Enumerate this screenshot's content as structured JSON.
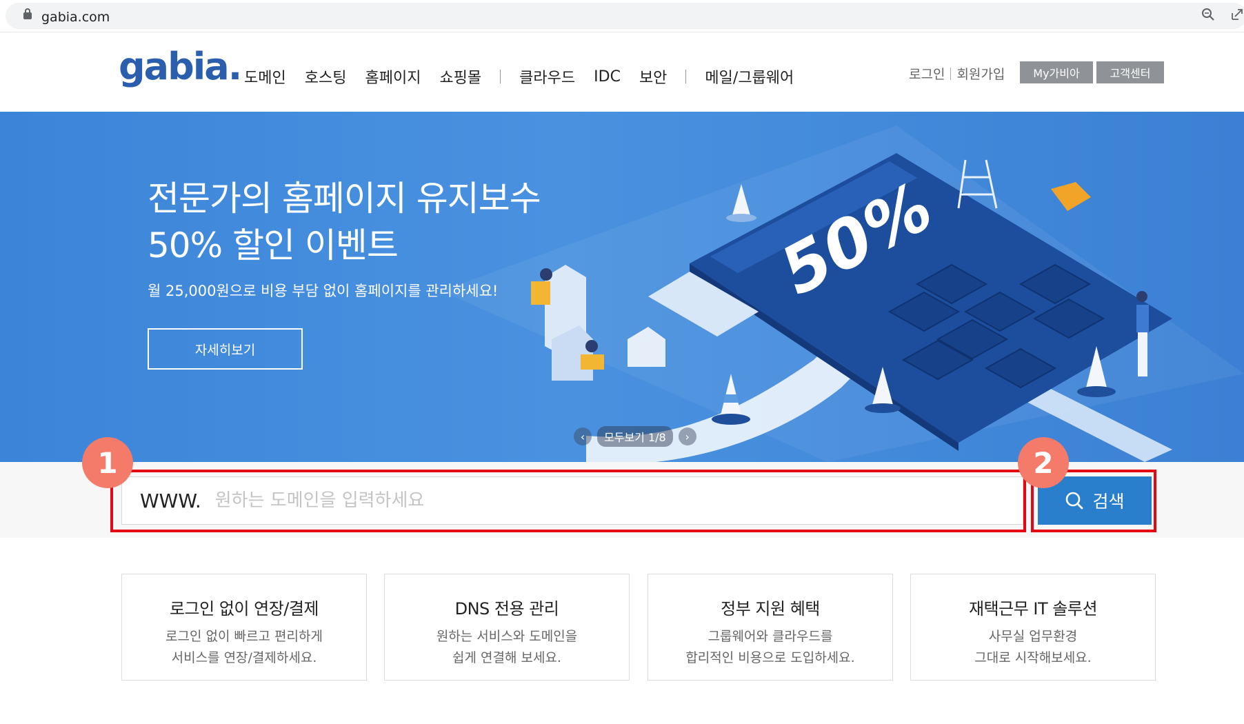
{
  "browser": {
    "url": "gabia.com"
  },
  "header": {
    "logo": "gabia.",
    "nav": [
      "도메인",
      "호스팅",
      "홈페이지",
      "쇼핑몰",
      "클라우드",
      "IDC",
      "보안",
      "메일/그룹웨어"
    ],
    "login": "로그인",
    "signup": "회원가입",
    "mygabia": "My가비아",
    "support": "고객센터"
  },
  "hero": {
    "title_line1": "전문가의 홈페이지 유지보수",
    "title_line2": "50% 할인 이벤트",
    "subtitle": "월 25,000원으로 비용 부담 없이 홈페이지를 관리하세요!",
    "button": "자세히보기",
    "graphic_text": "50%",
    "slide_prev": "‹",
    "slide_next": "›",
    "slide_counter": "모두보기 1/8"
  },
  "search": {
    "prefix": "WWW.",
    "placeholder": "원하는 도메인을 입력하세요",
    "button": "검색"
  },
  "annotations": {
    "badge1": "1",
    "badge2": "2",
    "color": "#e30613"
  },
  "cards": [
    {
      "title": "로그인 없이 연장/결제",
      "desc1": "로그인 없이 빠르고 편리하게",
      "desc2": "서비스를 연장/결제하세요."
    },
    {
      "title": "DNS 전용 관리",
      "desc1": "원하는 서비스와 도메인을",
      "desc2": "쉽게 연결해 보세요."
    },
    {
      "title": "정부 지원 혜택",
      "desc1": "그룹웨어와 클라우드를",
      "desc2": "합리적인 비용으로 도입하세요."
    },
    {
      "title": "재택근무 IT 솔루션",
      "desc1": "사무실 업무환경",
      "desc2": "그대로 시작해보세요."
    }
  ],
  "colors": {
    "brand": "#2b5fad",
    "hero_bg": "#4a92e0",
    "search_button": "#2a7fcc",
    "badge": "#f47a6a"
  }
}
